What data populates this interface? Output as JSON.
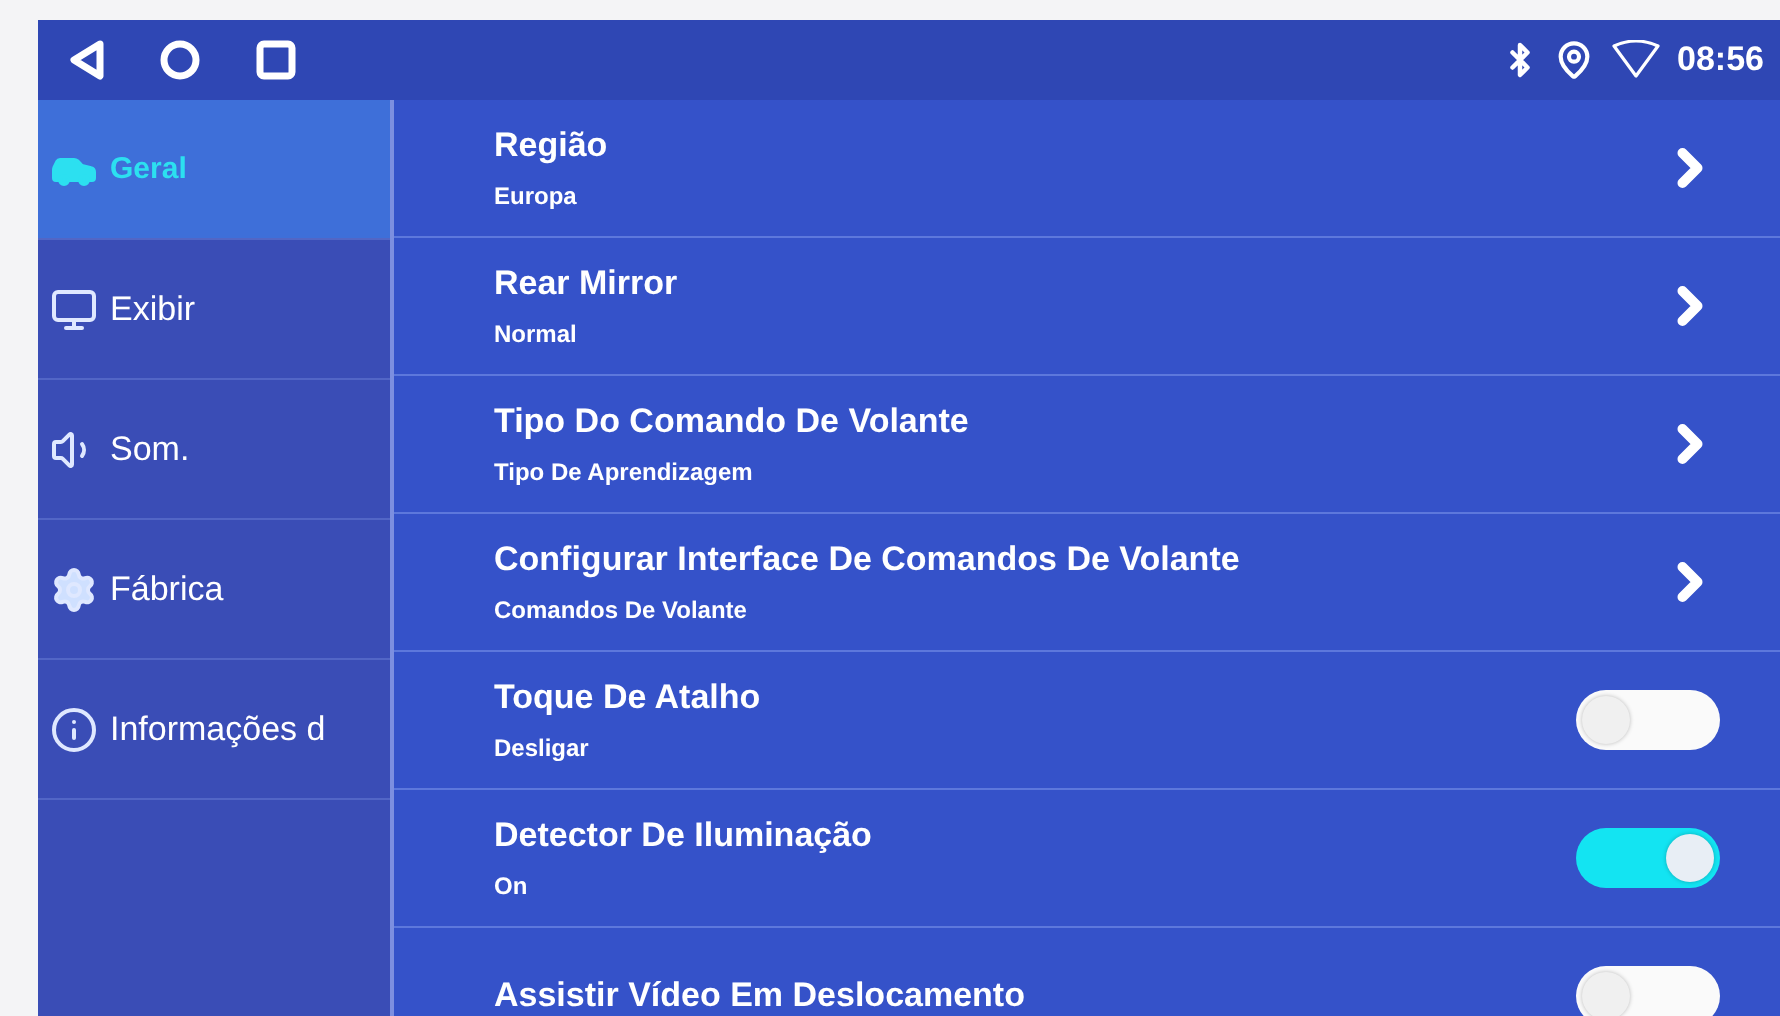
{
  "status_bar": {
    "time": "08:56"
  },
  "sidebar": {
    "items": [
      {
        "label": "Geral",
        "kind": "car",
        "selected": true
      },
      {
        "label": "Exibir",
        "kind": "display",
        "selected": false
      },
      {
        "label": "Som.",
        "kind": "sound",
        "selected": false
      },
      {
        "label": "Fábrica",
        "kind": "gear",
        "selected": false
      },
      {
        "label": "Informações d",
        "kind": "info",
        "selected": false
      }
    ]
  },
  "settings": [
    {
      "kind": "link",
      "title": "Região",
      "value": "Europa"
    },
    {
      "kind": "link",
      "title": "Rear Mirror",
      "value": "Normal"
    },
    {
      "kind": "link",
      "title": "Tipo Do Comando De Volante",
      "value": "Tipo De Aprendizagem"
    },
    {
      "kind": "link",
      "title": "Configurar Interface De Comandos De Volante",
      "value": "Comandos De Volante"
    },
    {
      "kind": "toggle",
      "title": "Toque De Atalho",
      "value": "Desligar",
      "on": false
    },
    {
      "kind": "toggle",
      "title": "Detector De Iluminação",
      "value": "On",
      "on": true
    },
    {
      "kind": "toggle",
      "title": "Assistir Vídeo Em Deslocamento",
      "on": false
    }
  ]
}
